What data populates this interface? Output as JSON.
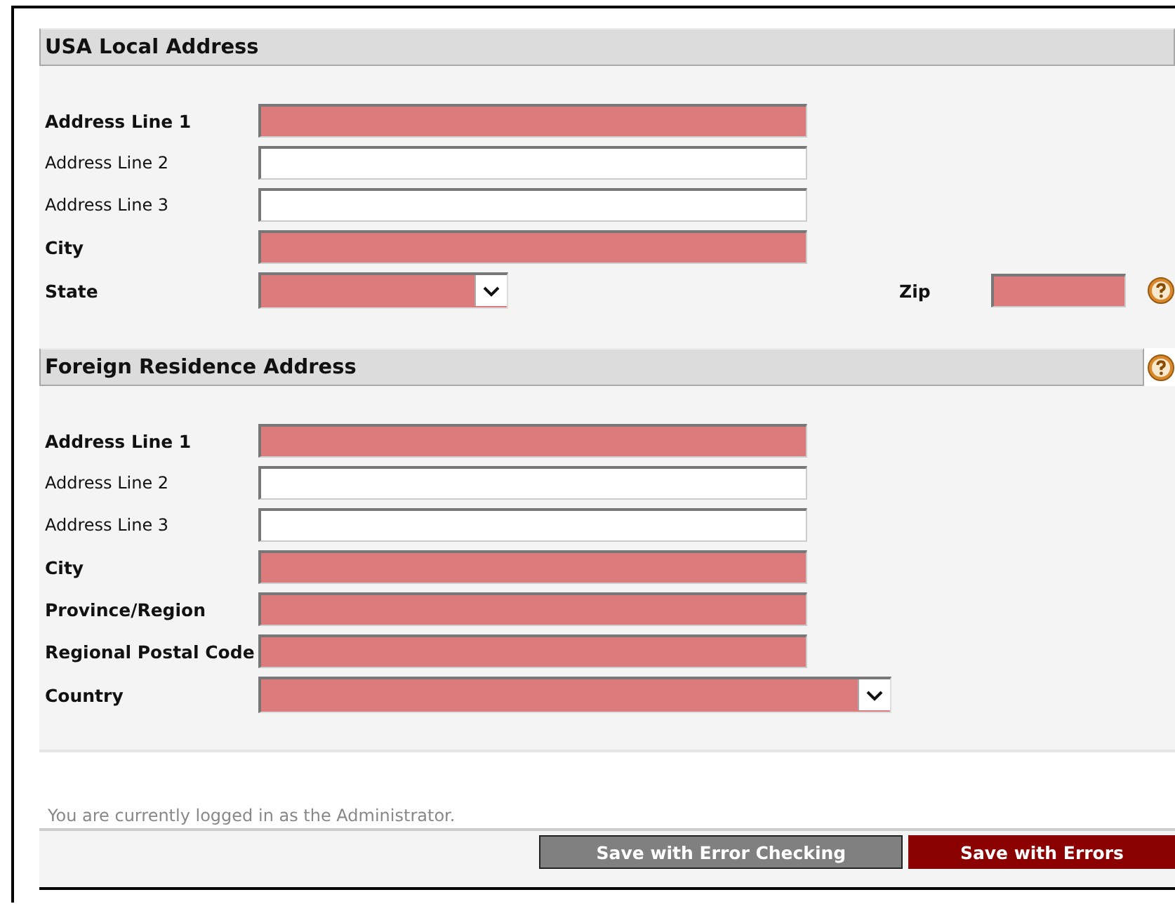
{
  "sections": [
    {
      "title": "USA Local Address",
      "fields": [
        {
          "label": "Address Line 1",
          "kind": "text",
          "required": true
        },
        {
          "label": "Address Line 2",
          "kind": "text",
          "required": false
        },
        {
          "label": "Address Line 3",
          "kind": "text",
          "required": false
        },
        {
          "label": "City",
          "kind": "text",
          "required": true
        },
        {
          "label": "State",
          "kind": "select-short",
          "required": true,
          "side": {
            "label": "Zip",
            "required": true,
            "help": true
          }
        }
      ]
    },
    {
      "title": "Foreign Residence Address",
      "help": true,
      "fields": [
        {
          "label": "Address Line 1",
          "kind": "text",
          "required": true
        },
        {
          "label": "Address Line 2",
          "kind": "text",
          "required": false
        },
        {
          "label": "Address Line 3",
          "kind": "text",
          "required": false
        },
        {
          "label": "City",
          "kind": "text",
          "required": true
        },
        {
          "label": "Province/Region",
          "kind": "text",
          "required": true
        },
        {
          "label": "Regional Postal Code",
          "kind": "text",
          "required": true
        },
        {
          "label": "Country",
          "kind": "select-long",
          "required": true
        }
      ]
    }
  ],
  "status": "You are currently logged in as the Administrator.",
  "buttons": [
    {
      "label": "Save with Error Checking",
      "kind": "check"
    },
    {
      "label": "Save with Errors",
      "kind": "force"
    }
  ]
}
